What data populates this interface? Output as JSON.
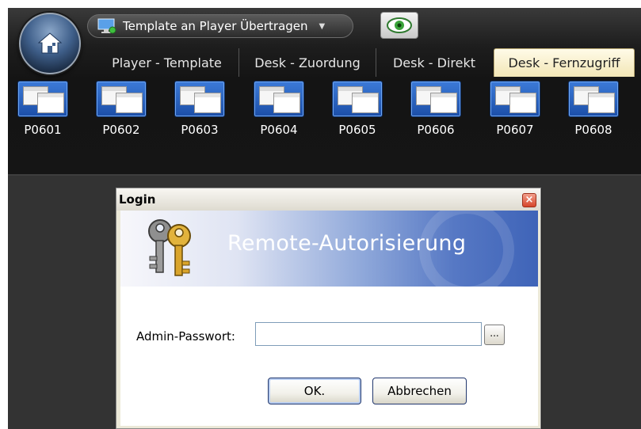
{
  "toolbar": {
    "template_button_label": "Template an Player Übertragen",
    "home_icon": "home-orb-icon",
    "monitor_icon": "monitor-icon",
    "eye_icon": "eye-icon"
  },
  "tabs": [
    {
      "label": "Player - Template"
    },
    {
      "label": "Desk - Zuordung"
    },
    {
      "label": "Desk - Direkt"
    },
    {
      "label": "Desk - Fernzugriff",
      "active": true
    }
  ],
  "players": [
    {
      "label": "P0601"
    },
    {
      "label": "P0602"
    },
    {
      "label": "P0603"
    },
    {
      "label": "P0604"
    },
    {
      "label": "P0605"
    },
    {
      "label": "P0606"
    },
    {
      "label": "P0607"
    },
    {
      "label": "P0608"
    }
  ],
  "dialog": {
    "title": "Login",
    "close_icon": "close-icon",
    "banner_title": "Remote-Autorisierung",
    "keys_icon": "keys-icon",
    "password_label": "Admin-Passwort:",
    "password_value": "",
    "more_button_label": "...",
    "ok_label": "OK.",
    "cancel_label": "Abbrechen"
  },
  "colors": {
    "app_background": "#333333",
    "ribbon": "#1d1d1d",
    "active_tab": "#f7efcb",
    "dialog_background": "#ece9d8",
    "banner_accent": "#3f64b8",
    "close_button": "#d6452b"
  }
}
